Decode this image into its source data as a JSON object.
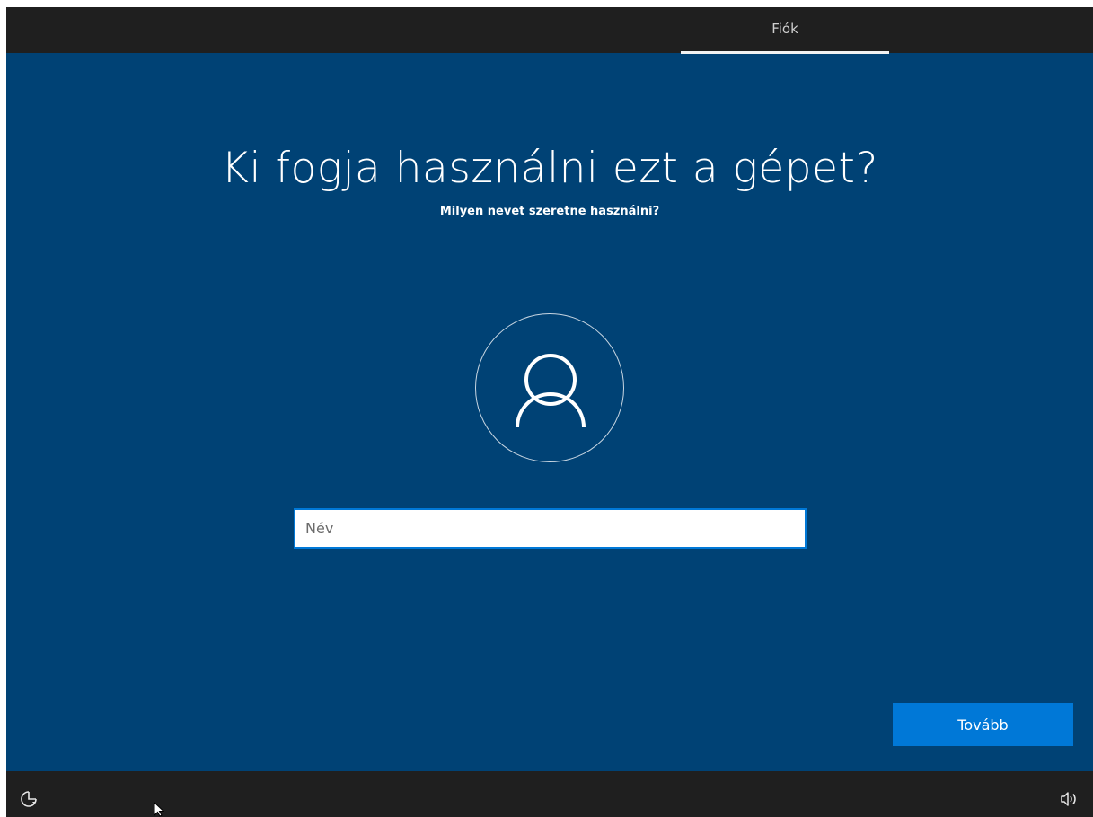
{
  "header": {
    "active_tab": "Fiók"
  },
  "page": {
    "title": "Ki fogja használni ezt a gépet?",
    "subtitle": "Milyen nevet szeretne használni?"
  },
  "form": {
    "name_placeholder": "Név",
    "name_value": ""
  },
  "actions": {
    "next_label": "Tovább"
  },
  "footer": {
    "left_icon": "ease-of-access-icon",
    "right_icon": "volume-icon"
  },
  "colors": {
    "background": "#004275",
    "bars": "#1f1f1f",
    "accent": "#0078d7"
  }
}
